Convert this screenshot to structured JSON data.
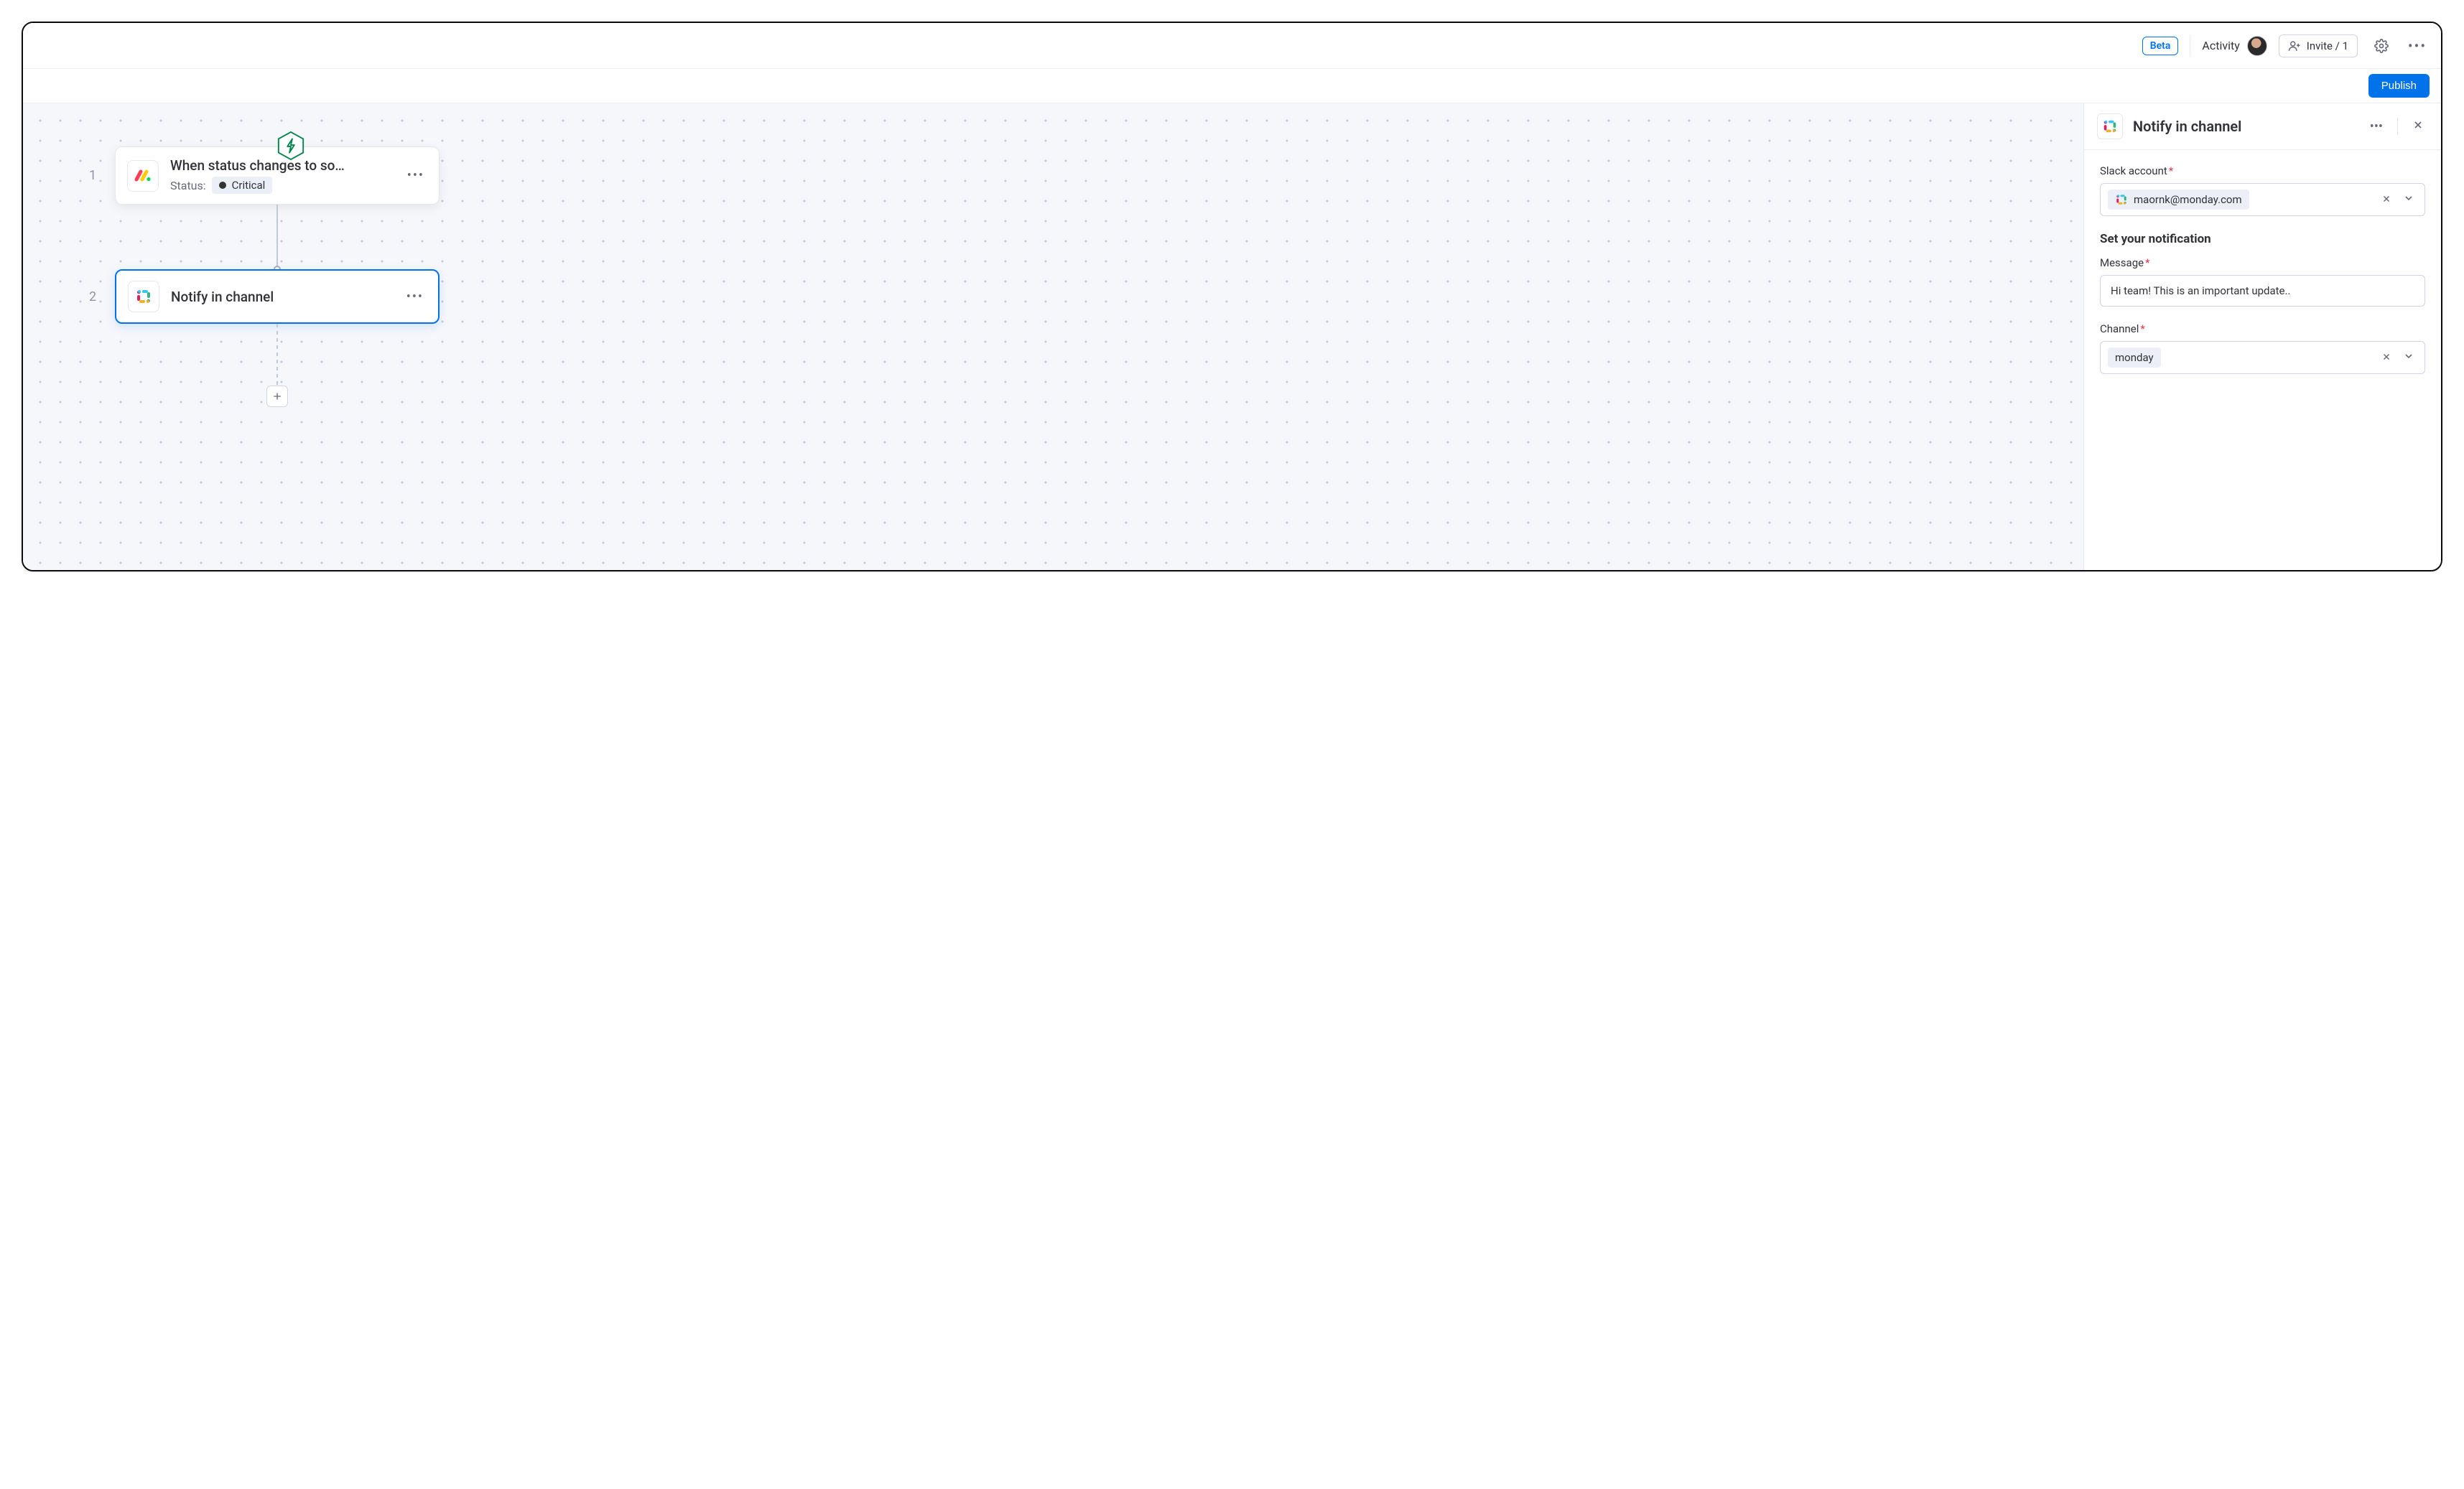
{
  "topbar": {
    "beta_label": "Beta",
    "activity_label": "Activity",
    "invite_label": "Invite / 1"
  },
  "actionbar": {
    "publish_label": "Publish"
  },
  "canvas": {
    "steps": [
      {
        "num": "1",
        "title": "When status changes to so…",
        "subtitle_label": "Status:",
        "status_value": "Critical",
        "app": "monday"
      },
      {
        "num": "2",
        "title": "Notify in channel",
        "app": "slack"
      }
    ]
  },
  "sidepanel": {
    "title": "Notify in channel",
    "fields": {
      "slack_account": {
        "label": "Slack account",
        "value": "maornk@monday.com"
      },
      "message": {
        "label": "Message",
        "value": "Hi team! This is an important update.."
      },
      "channel": {
        "label": "Channel",
        "value": "monday"
      }
    },
    "section_heading": "Set your notification"
  }
}
